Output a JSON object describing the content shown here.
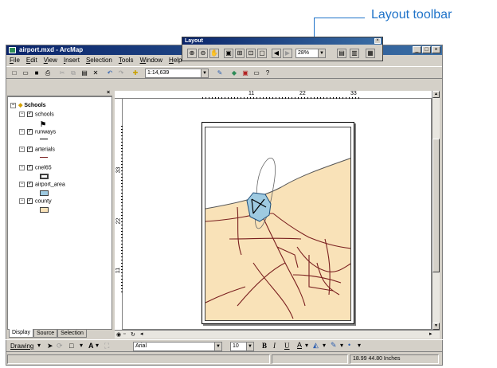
{
  "callout": {
    "label": "Layout toolbar"
  },
  "window": {
    "title": "airport.mxd - ArcMap"
  },
  "menu": [
    "File",
    "Edit",
    "View",
    "Insert",
    "Selection",
    "Tools",
    "Window",
    "Help"
  ],
  "toolbar": {
    "scale_value": "1:14,639"
  },
  "layout_toolbar": {
    "title": "Layout",
    "zoom_value": "28%"
  },
  "toc": {
    "group_name": "Schools",
    "layers": [
      {
        "name": "schools"
      },
      {
        "name": "runways"
      },
      {
        "name": "arterials"
      },
      {
        "name": "cnel65"
      },
      {
        "name": "airport_area"
      },
      {
        "name": "county"
      }
    ],
    "tabs": [
      "Display",
      "Source",
      "Selection"
    ]
  },
  "rulers": {
    "top": [
      "11",
      "22",
      "33"
    ],
    "left": [
      "33",
      "22",
      "11"
    ]
  },
  "drawing": {
    "menu_label": "Drawing",
    "font_name": "Arial",
    "font_size": "10",
    "bold": "B",
    "italic": "I",
    "underline": "U",
    "font_color": "A"
  },
  "status": {
    "coords": "18.99  44.80 Inches"
  },
  "colors": {
    "map_fill": "#f9e2b8",
    "roads": "#7a1f1f",
    "airport": "#9ecae1",
    "callout": "#1f73c9"
  }
}
